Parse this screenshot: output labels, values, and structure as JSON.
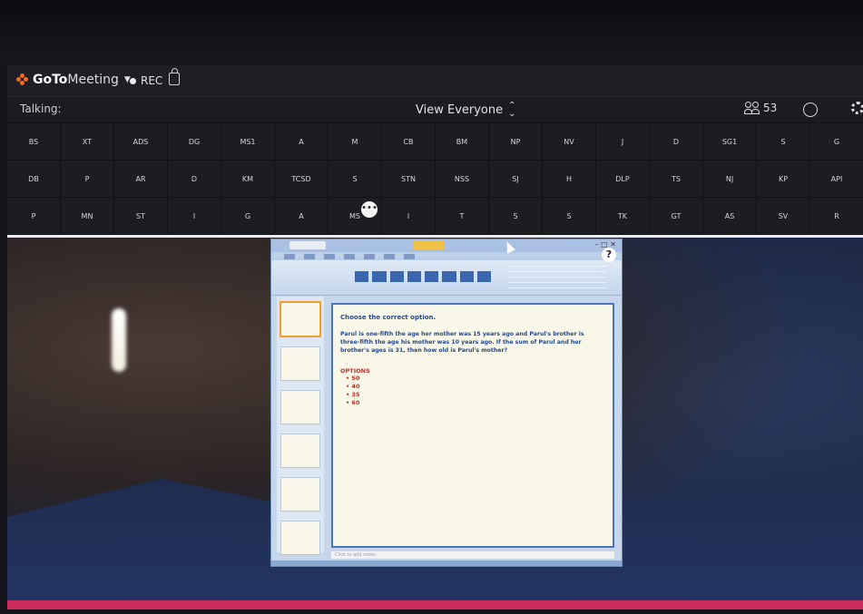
{
  "app": {
    "brand_bold": "GoTo",
    "brand_light": "Meeting",
    "rec_label": "REC",
    "talking_label": "Talking:",
    "view_label": "View Everyone",
    "attendee_count": "53",
    "colors": {
      "accent": "#f26b2a",
      "divider": "#e9e9ee",
      "taskbar": "#c92c5c"
    }
  },
  "participants": [
    "BS",
    "XT",
    "ADS",
    "DG",
    "MS1",
    "A",
    "M",
    "CB",
    "BM",
    "NP",
    "NV",
    "J",
    "D",
    "SG1",
    "S",
    "G",
    "DB",
    "P",
    "AR",
    "D",
    "KM",
    "TCSD",
    "S",
    "STN",
    "NSS",
    "SJ",
    "H",
    "DLP",
    "TS",
    "NJ",
    "KP",
    "API",
    "P",
    "MN",
    "ST",
    "I",
    "G",
    "A",
    "MS",
    "I",
    "T",
    "S",
    "S",
    "TK",
    "GT",
    "AS",
    "SV",
    "R"
  ],
  "slide": {
    "heading": "Choose the correct option.",
    "question": "Parul is one-fifth the age her mother was 15 years ago and Parul's brother is three-fifth the age his mother was 10 years ago. If the sum of Parul and her brother's ages is 31, then how old is Parul's mother?",
    "options_title": "OPTIONS",
    "options": [
      "50",
      "40",
      "35",
      "60"
    ],
    "notes_placeholder": "Click to add notes"
  }
}
